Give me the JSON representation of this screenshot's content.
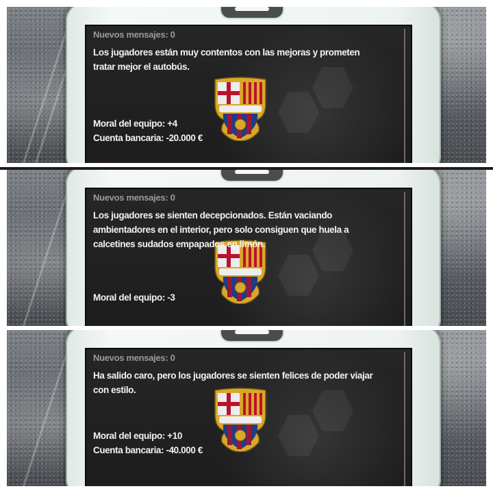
{
  "panels": [
    {
      "header": "Nuevos mensajes: 0",
      "message": "Los jugadores están muy contentos con las mejoras y prometen tratar mejor el autobús.",
      "stats": [
        "Moral del equipo: +4",
        "Cuenta bancaria: -20.000 €"
      ]
    },
    {
      "header": "Nuevos mensajes: 0",
      "message": "Los jugadores se sienten decepcionados. Están vaciando ambientadores en el interior, pero solo consiguen que huela a calcetines sudados empapados en limón.",
      "stats": [
        "Moral del equipo: -3"
      ]
    },
    {
      "header": "Nuevos mensajes: 0",
      "message": "Ha salido caro, pero los jugadores se sienten felices de poder viajar con estilo.",
      "stats": [
        "Moral del equipo: +10",
        "Cuenta bancaria: -40.000 €"
      ]
    }
  ],
  "crest": {
    "initials": "FCB",
    "colors": {
      "blue": "#1f3f8f",
      "claret": "#a3163a",
      "gold": "#e8b42a",
      "white": "#ffffff"
    }
  }
}
